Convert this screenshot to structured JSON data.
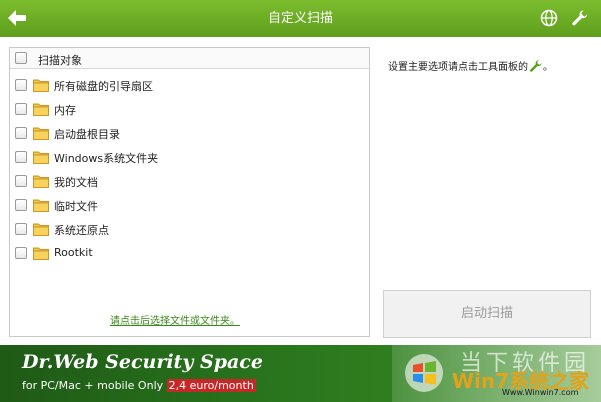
{
  "window": {
    "title": "自定义扫描"
  },
  "colors": {
    "accent": "#6aab22",
    "banner_bg": "#2b7a1e",
    "price_bg": "#c62828",
    "link": "#3a8a1a"
  },
  "toolbar": {
    "back_icon": "back-arrow-icon",
    "globe_icon": "globe-icon",
    "wrench_icon": "wrench-icon"
  },
  "scan_targets": {
    "header_label": "扫描对象",
    "items": [
      {
        "label": "所有磁盘的引导扇区",
        "checked": false
      },
      {
        "label": "内存",
        "checked": false
      },
      {
        "label": "启动盘根目录",
        "checked": false
      },
      {
        "label": "Windows系统文件夹",
        "checked": false
      },
      {
        "label": "我的文档",
        "checked": false
      },
      {
        "label": "临时文件",
        "checked": false
      },
      {
        "label": "系统还原点",
        "checked": false
      },
      {
        "label": "Rootkit",
        "checked": false
      }
    ],
    "pick_link": "请点击后选择文件或文件夹。"
  },
  "hint": {
    "text": "设置主要选项请点击工具面板的",
    "end": "。"
  },
  "scan_button": {
    "label": "启动扫描"
  },
  "banner": {
    "title": "Dr.Web Security Space",
    "subtitle": "for PC/Mac + mobile Only ",
    "price": "2,4 euro/month"
  },
  "watermark": {
    "line1": "当下软件园",
    "line2": "Win7系统之家",
    "url": "Www.Winwin7.com"
  }
}
